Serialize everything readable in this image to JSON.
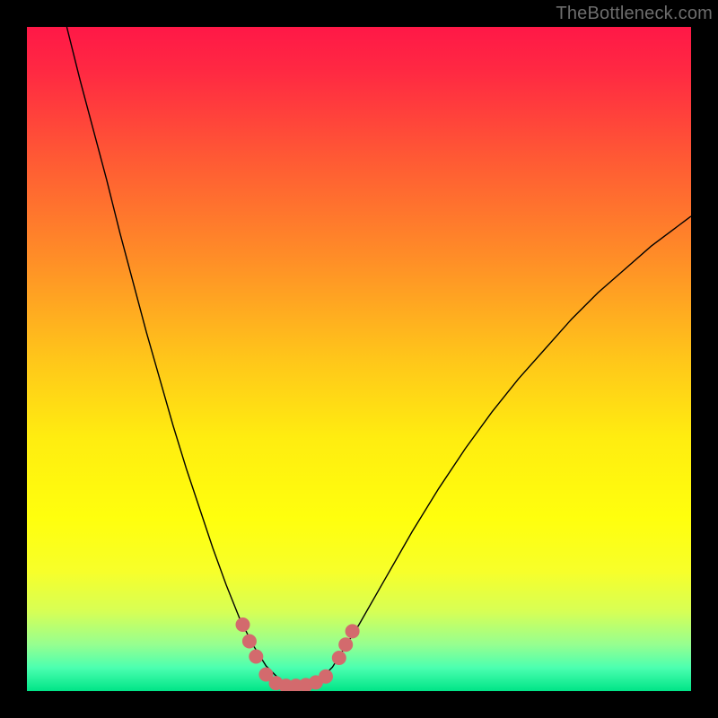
{
  "watermark": "TheBottleneck.com",
  "chart_data": {
    "type": "line",
    "title": "",
    "xlabel": "",
    "ylabel": "",
    "xlim": [
      0,
      100
    ],
    "ylim": [
      0,
      100
    ],
    "background_gradient": {
      "stops": [
        {
          "offset": 0.0,
          "color": "#ff1847"
        },
        {
          "offset": 0.07,
          "color": "#ff2a42"
        },
        {
          "offset": 0.2,
          "color": "#ff5a34"
        },
        {
          "offset": 0.35,
          "color": "#ff8e27"
        },
        {
          "offset": 0.5,
          "color": "#ffc61a"
        },
        {
          "offset": 0.62,
          "color": "#ffed10"
        },
        {
          "offset": 0.74,
          "color": "#ffff0d"
        },
        {
          "offset": 0.82,
          "color": "#f7ff2a"
        },
        {
          "offset": 0.88,
          "color": "#d7ff55"
        },
        {
          "offset": 0.93,
          "color": "#96ff90"
        },
        {
          "offset": 0.965,
          "color": "#4bffb0"
        },
        {
          "offset": 1.0,
          "color": "#00e487"
        }
      ]
    },
    "series": [
      {
        "name": "bottleneck-curve",
        "stroke": "#000000",
        "stroke_width": 1.4,
        "points": [
          {
            "x": 6.0,
            "y": 100.0
          },
          {
            "x": 8.0,
            "y": 92.0
          },
          {
            "x": 10.0,
            "y": 84.5
          },
          {
            "x": 12.0,
            "y": 77.0
          },
          {
            "x": 14.0,
            "y": 69.0
          },
          {
            "x": 16.0,
            "y": 61.5
          },
          {
            "x": 18.0,
            "y": 54.0
          },
          {
            "x": 20.0,
            "y": 47.0
          },
          {
            "x": 22.0,
            "y": 40.0
          },
          {
            "x": 24.0,
            "y": 33.5
          },
          {
            "x": 26.0,
            "y": 27.5
          },
          {
            "x": 28.0,
            "y": 21.5
          },
          {
            "x": 30.0,
            "y": 16.0
          },
          {
            "x": 32.0,
            "y": 11.0
          },
          {
            "x": 34.0,
            "y": 7.0
          },
          {
            "x": 36.0,
            "y": 3.8
          },
          {
            "x": 38.0,
            "y": 1.8
          },
          {
            "x": 40.0,
            "y": 0.8
          },
          {
            "x": 42.0,
            "y": 0.8
          },
          {
            "x": 44.0,
            "y": 1.6
          },
          {
            "x": 46.0,
            "y": 3.6
          },
          {
            "x": 48.0,
            "y": 6.8
          },
          {
            "x": 50.0,
            "y": 10.0
          },
          {
            "x": 54.0,
            "y": 17.0
          },
          {
            "x": 58.0,
            "y": 24.0
          },
          {
            "x": 62.0,
            "y": 30.5
          },
          {
            "x": 66.0,
            "y": 36.5
          },
          {
            "x": 70.0,
            "y": 42.0
          },
          {
            "x": 74.0,
            "y": 47.0
          },
          {
            "x": 78.0,
            "y": 51.5
          },
          {
            "x": 82.0,
            "y": 56.0
          },
          {
            "x": 86.0,
            "y": 60.0
          },
          {
            "x": 90.0,
            "y": 63.5
          },
          {
            "x": 94.0,
            "y": 67.0
          },
          {
            "x": 98.0,
            "y": 70.0
          },
          {
            "x": 100.0,
            "y": 71.5
          }
        ]
      }
    ],
    "markers": {
      "name": "highlight-dots",
      "fill": "#d36a6d",
      "radius": 8,
      "points": [
        {
          "x": 32.5,
          "y": 10.0
        },
        {
          "x": 33.5,
          "y": 7.5
        },
        {
          "x": 34.5,
          "y": 5.2
        },
        {
          "x": 36.0,
          "y": 2.5
        },
        {
          "x": 37.5,
          "y": 1.2
        },
        {
          "x": 39.0,
          "y": 0.8
        },
        {
          "x": 40.5,
          "y": 0.8
        },
        {
          "x": 42.0,
          "y": 0.9
        },
        {
          "x": 43.5,
          "y": 1.3
        },
        {
          "x": 45.0,
          "y": 2.2
        },
        {
          "x": 47.0,
          "y": 5.0
        },
        {
          "x": 48.0,
          "y": 7.0
        },
        {
          "x": 49.0,
          "y": 9.0
        }
      ]
    }
  }
}
